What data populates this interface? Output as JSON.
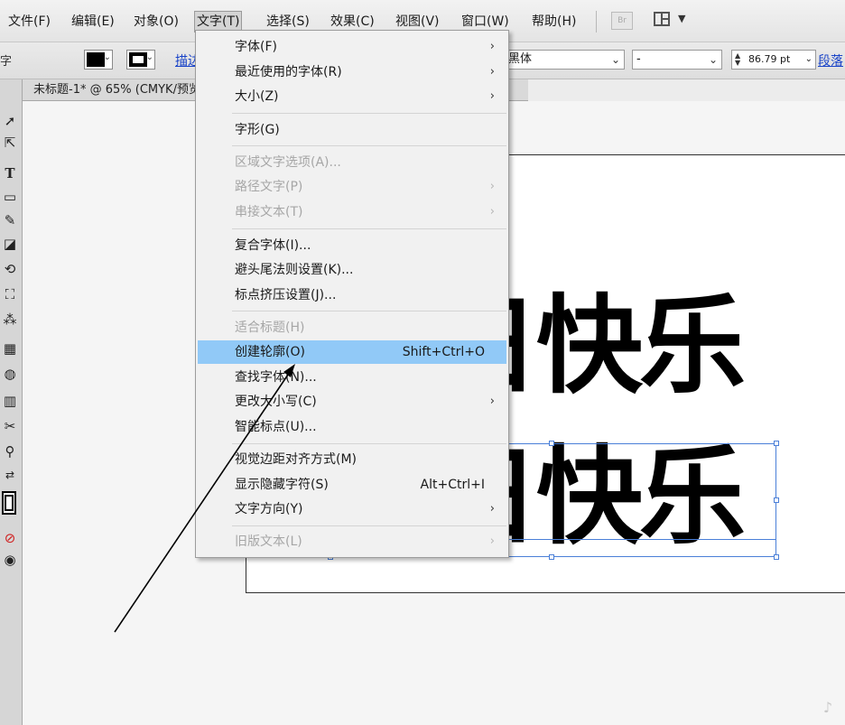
{
  "menubar": {
    "items": [
      "文件(F)",
      "编辑(E)",
      "对象(O)",
      "文字(T)",
      "选择(S)",
      "效果(C)",
      "视图(V)",
      "窗口(W)",
      "帮助(H)"
    ],
    "bridge_label": "Br"
  },
  "controlbar": {
    "left_label": "字",
    "stroke_link": "描边",
    "font_family": "黑体",
    "font_style": "-",
    "font_size": "86.79 pt",
    "paragraph_link": "段落"
  },
  "document": {
    "tab_title": "未标题-1* @ 65% (CMYK/预览)",
    "line1": "生日快乐",
    "line2": "生日快乐"
  },
  "text_menu": {
    "items": [
      {
        "label": "字体(F)",
        "shortcut": "",
        "submenu": true,
        "disabled": false
      },
      {
        "label": "最近使用的字体(R)",
        "shortcut": "",
        "submenu": true,
        "disabled": false
      },
      {
        "label": "大小(Z)",
        "shortcut": "",
        "submenu": true,
        "disabled": false
      },
      {
        "label": "字形(G)",
        "shortcut": "",
        "submenu": false,
        "disabled": false
      },
      {
        "label": "区域文字选项(A)...",
        "shortcut": "",
        "submenu": false,
        "disabled": true
      },
      {
        "label": "路径文字(P)",
        "shortcut": "",
        "submenu": true,
        "disabled": true
      },
      {
        "label": "串接文本(T)",
        "shortcut": "",
        "submenu": true,
        "disabled": true
      },
      {
        "label": "复合字体(I)...",
        "shortcut": "",
        "submenu": false,
        "disabled": false
      },
      {
        "label": "避头尾法则设置(K)...",
        "shortcut": "",
        "submenu": false,
        "disabled": false
      },
      {
        "label": "标点挤压设置(J)...",
        "shortcut": "",
        "submenu": false,
        "disabled": false
      },
      {
        "label": "适合标题(H)",
        "shortcut": "",
        "submenu": false,
        "disabled": true
      },
      {
        "label": "创建轮廓(O)",
        "shortcut": "Shift+Ctrl+O",
        "submenu": false,
        "disabled": false,
        "highlighted": true
      },
      {
        "label": "查找字体(N)...",
        "shortcut": "",
        "submenu": false,
        "disabled": false
      },
      {
        "label": "更改大小写(C)",
        "shortcut": "",
        "submenu": true,
        "disabled": false
      },
      {
        "label": "智能标点(U)...",
        "shortcut": "",
        "submenu": false,
        "disabled": false
      },
      {
        "label": "视觉边距对齐方式(M)",
        "shortcut": "",
        "submenu": false,
        "disabled": false
      },
      {
        "label": "显示隐藏字符(S)",
        "shortcut": "Alt+Ctrl+I",
        "submenu": false,
        "disabled": false
      },
      {
        "label": "文字方向(Y)",
        "shortcut": "",
        "submenu": true,
        "disabled": false
      },
      {
        "label": "旧版文本(L)",
        "shortcut": "",
        "submenu": true,
        "disabled": true
      }
    ]
  },
  "tools": [
    "selection-tool",
    "direct-selection-tool",
    "type-tool",
    "rectangle-tool",
    "paintbrush-tool",
    "eraser-tool",
    "rotate-tool",
    "free-transform-tool",
    "symbol-sprayer-tool",
    "gradient-tool",
    "blend-tool",
    "column-graph-tool",
    "slice-tool",
    "zoom-tool",
    "swap-fill-stroke",
    "fill-stroke-swatch",
    "none-color",
    "drawing-mode"
  ],
  "colors": {
    "menu_highlight": "#91c9f7",
    "selection": "#4a7fd8",
    "link": "#1a44c8"
  }
}
